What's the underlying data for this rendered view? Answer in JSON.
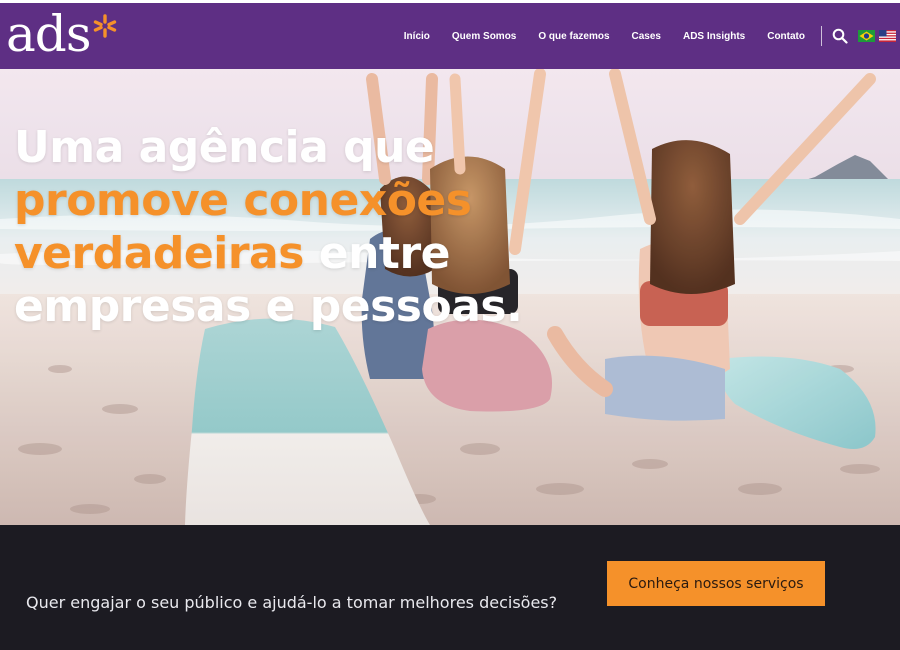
{
  "logo": {
    "text": "ads",
    "accent_color": "#f5912a"
  },
  "nav": {
    "items": [
      {
        "label": "Início"
      },
      {
        "label": "Quem Somos"
      },
      {
        "label": "O que fazemos"
      },
      {
        "label": "Cases"
      },
      {
        "label": "ADS Insights"
      },
      {
        "label": "Contato"
      }
    ],
    "search_icon": "search-icon",
    "languages": [
      {
        "icon": "flag-brazil-icon"
      },
      {
        "icon": "flag-usa-icon"
      }
    ]
  },
  "hero": {
    "line1": "Uma agência que",
    "line2": "promove conexões",
    "line3_highlight": "verdadeiras",
    "line3_rest": " entre",
    "line4": "empresas e pessoas.",
    "image": "beach-photo-girls-with-surfboards"
  },
  "cta": {
    "text": "Quer engajar o seu público e ajudá-lo a tomar melhores decisões?",
    "button_label": "Conheça nossos serviços"
  },
  "colors": {
    "header_bg": "#5e2f84",
    "accent": "#f5912a",
    "footer_bg": "#1c1b22"
  }
}
